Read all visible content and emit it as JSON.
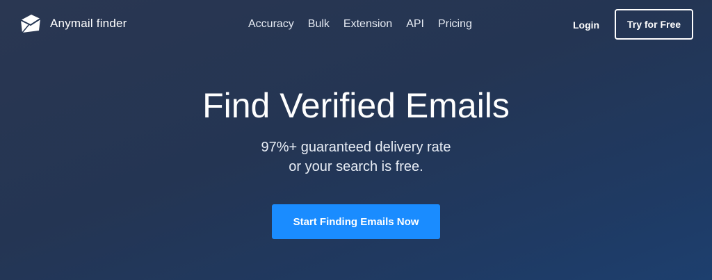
{
  "header": {
    "brand": "Anymail finder",
    "brand_icon": "envelope-icon",
    "nav": [
      {
        "label": "Accuracy"
      },
      {
        "label": "Bulk"
      },
      {
        "label": "Extension"
      },
      {
        "label": "API"
      },
      {
        "label": "Pricing"
      }
    ],
    "login_label": "Login",
    "cta_label": "Try for Free"
  },
  "hero": {
    "title": "Find Verified Emails",
    "subtitle_line1": "97%+ guaranteed delivery rate",
    "subtitle_line2": "or your search is free.",
    "button_label": "Start Finding Emails Now"
  },
  "colors": {
    "background": "#243553",
    "accent": "#1a8cff",
    "text": "#ffffff"
  }
}
